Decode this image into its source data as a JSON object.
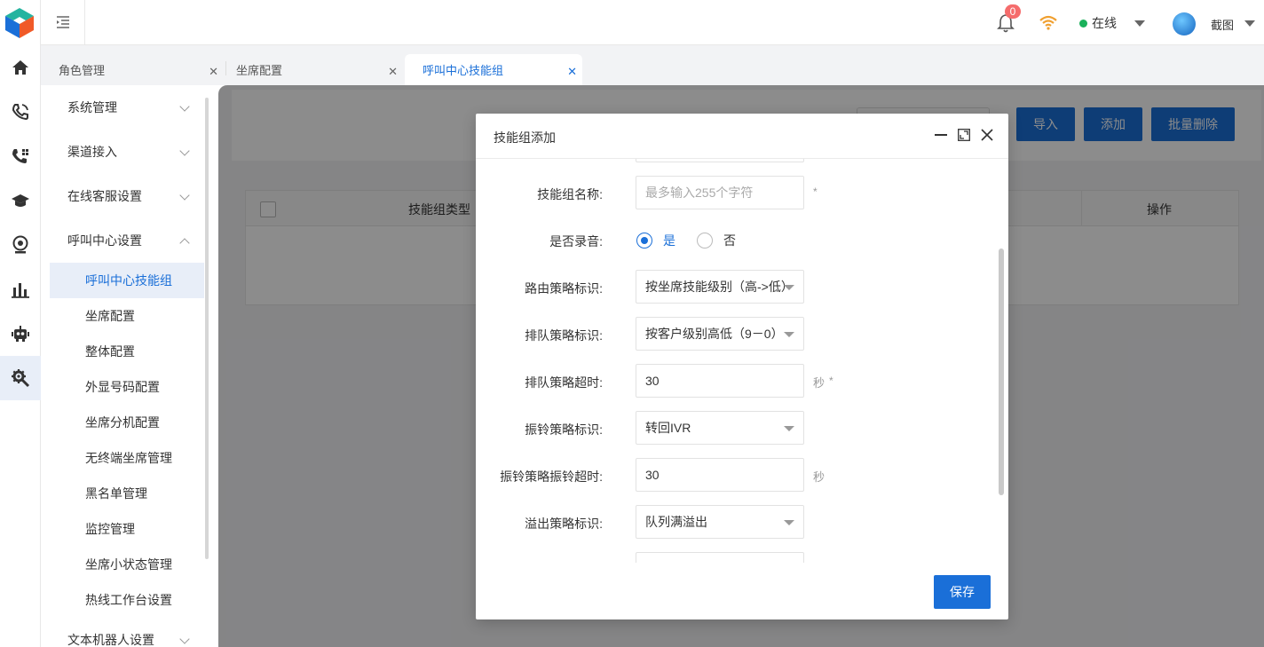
{
  "topbar": {
    "notification_count": "0",
    "status": "在线",
    "username": "截图"
  },
  "tabs": [
    {
      "label": "角色管理"
    },
    {
      "label": "坐席配置"
    },
    {
      "label": "呼叫中心技能组"
    }
  ],
  "menu": {
    "groups": [
      "系统管理",
      "渠道接入",
      "在线客服设置",
      "呼叫中心设置"
    ],
    "sub_items": [
      "呼叫中心技能组",
      "坐席配置",
      "整体配置",
      "外显号码配置",
      "坐席分机配置",
      "无终端坐席管理",
      "黑名单管理",
      "监控管理",
      "坐席小状态管理",
      "热线工作台设置"
    ],
    "last_group": "文本机器人设置"
  },
  "toolbar": {
    "import_label": "导入",
    "add_label": "添加",
    "batch_delete_label": "批量删除"
  },
  "table": {
    "columns": [
      "技能组类型",
      "操作"
    ]
  },
  "dialog": {
    "title": "技能组添加",
    "fields": {
      "name_label": "技能组名称:",
      "name_placeholder": "最多输入255个字符",
      "required_mark": "*",
      "record_label": "是否录音:",
      "record_yes": "是",
      "record_no": "否",
      "routing_label": "路由策略标识:",
      "routing_value": "按坐席技能级别（高->低）",
      "queue_label": "排队策略标识:",
      "queue_value": "按客户级别高低（9－0）",
      "queue_timeout_label": "排队策略超时:",
      "queue_timeout_value": "30",
      "second_unit": "秒",
      "ring_label": "振铃策略标识:",
      "ring_value": "转回IVR",
      "ring_timeout_label": "振铃策略振铃超时:",
      "ring_timeout_value": "30",
      "overflow_label": "溢出策略标识:",
      "overflow_value": "队列满溢出"
    },
    "save_label": "保存"
  },
  "colors": {
    "primary": "#1a6fd8",
    "online": "#1ab15a",
    "badge": "#f56c6c"
  }
}
